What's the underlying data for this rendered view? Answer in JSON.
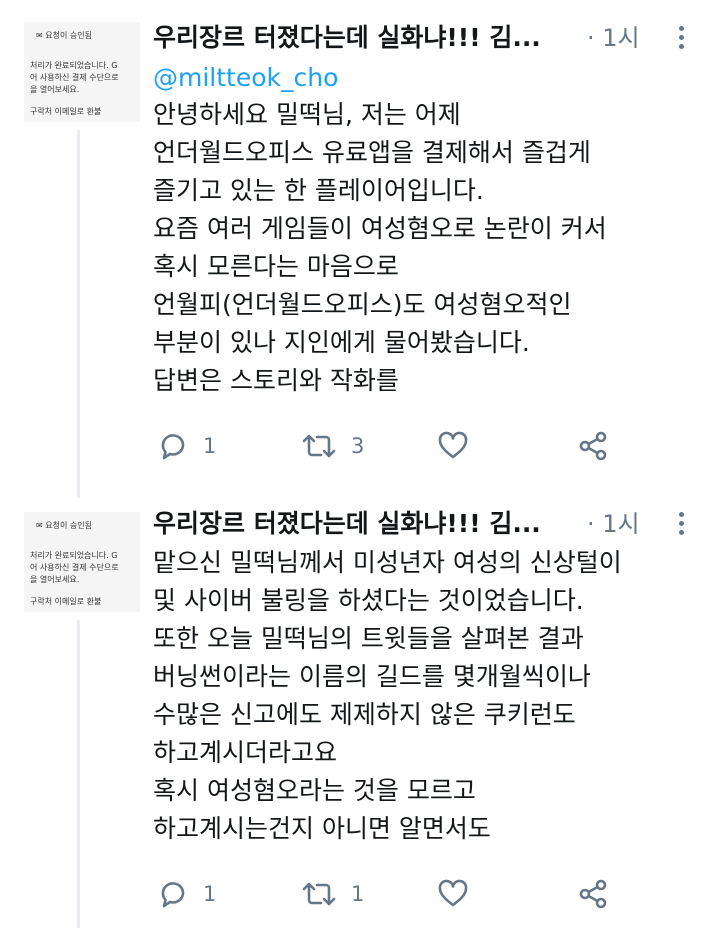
{
  "tweets": [
    {
      "author_name": "우리장르 터졌다는데 실화냐!!! 김...",
      "time": "· 1시",
      "mention": "@miltteok_cho",
      "lines": [
        "안녕하세요 밀떡님, 저는 어제",
        "언더월드오피스 유료앱을 결제해서 즐겁게",
        "즐기고 있는 한 플레이어입니다.",
        "요즘 여러 게임들이 여성혐오로 논란이 커서",
        "혹시 모른다는 마음으로",
        "언월피(언더월드오피스)도 여성혐오적인",
        "부분이 있나 지인에게 물어봤습니다.",
        "답변은 스토리와 작화를"
      ],
      "reply_count": "1",
      "retweet_count": "3",
      "avatar_lines": [
        "✉ 요청이 승인됨",
        "처리가 완료되었습니다. G",
        "어 사용하신 결제 수단으로",
        "을 열어보세요.",
        "구락처 이메일로 환불"
      ]
    },
    {
      "author_name": "우리장르 터졌다는데 실화냐!!! 김...",
      "time": "· 1시",
      "lines": [
        "맡으신 밀떡님께서 미성년자 여성의 신상털이",
        "및 사이버 불링을 하셨다는 것이었습니다.",
        "또한 오늘 밀떡님의 트윗들을 살펴본 결과",
        "버닝썬이라는 이름의 길드를 몇개월씩이나",
        "수많은 신고에도 제제하지 않은 쿠키런도",
        "하고계시더라고요",
        "혹시 여성혐오라는 것을 모르고",
        "하고계시는건지 아니면 알면서도"
      ],
      "reply_count": "1",
      "retweet_count": "1",
      "avatar_lines": [
        "✉ 요청이 승인됨",
        "처리가 완료되었습니다. G",
        "어 사용하신 결제 수단으로",
        "을 열어보세요.",
        "구락처 이메일로 환불"
      ]
    }
  ],
  "colors": {
    "text": "#14171a",
    "secondary": "#657786",
    "link": "#1da1f2",
    "thread_line": "#e6ecf0"
  },
  "icons": [
    "reply-icon",
    "retweet-icon",
    "like-icon",
    "share-icon",
    "more-icon"
  ]
}
